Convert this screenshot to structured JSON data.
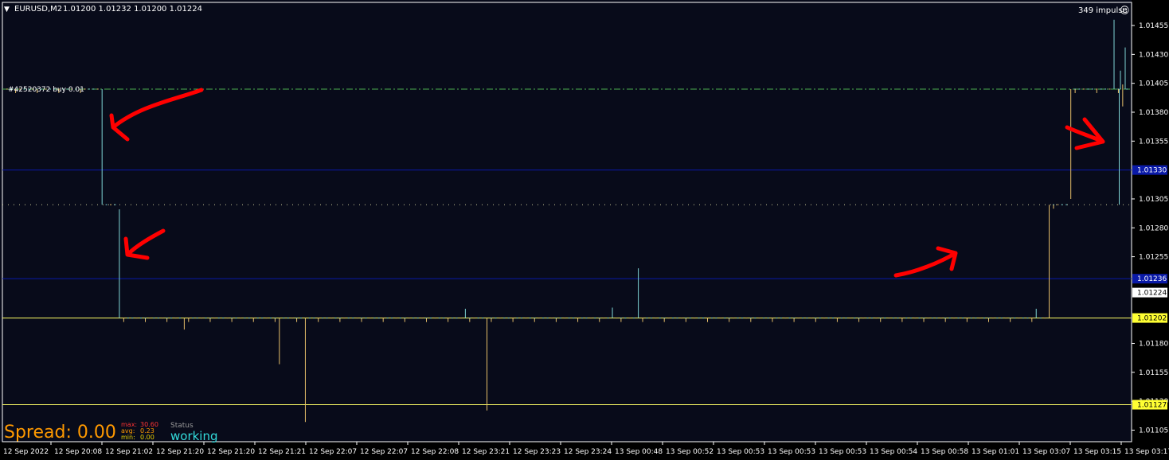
{
  "header": {
    "caret": "▼",
    "symbol_timeframe": "EURUSD,M2",
    "ohlc": "1.01200 1.01232 1.01200 1.01224",
    "indicator_label": "349 impulse",
    "smiley_glyph": "☺"
  },
  "trade": {
    "label": "#42520372 buy 0.01"
  },
  "spread": {
    "label": "Spread: 0.00",
    "max_label": "max:",
    "max_value": "30.60",
    "avg_label": "avg:",
    "avg_value": "0.23",
    "min_label": "min:",
    "min_value": "0.00",
    "status_label": "Status",
    "status_value": "working"
  },
  "colors": {
    "background": "#080b1a",
    "axis_bg": "#000000",
    "grid_text": "#ffffff",
    "bull": "#7fd6d6",
    "bear": "#e8c06a",
    "yellow_line": "#ffff66",
    "blue_line": "#0a1aa8",
    "trade_line": "#4caf50",
    "arrow_red": "#ff0000",
    "spread_orange": "#ff9900",
    "max_red": "#ff3333",
    "avg_orange": "#ff9900",
    "min_yellow": "#e8d000",
    "status_grey": "#9a9a9a",
    "working_cyan": "#33dddd"
  },
  "chart_data": {
    "type": "candlestick",
    "title": "EURUSD,M2",
    "ylim": [
      1.01095,
      1.01475
    ],
    "y_ticks": [
      "1.01455",
      "1.01430",
      "1.01405",
      "1.01380",
      "1.01355",
      "1.01305",
      "1.01280",
      "1.01255",
      "1.01180",
      "1.01155",
      "1.01130",
      "1.01105"
    ],
    "price_labels": [
      {
        "value": 1.0133,
        "text": "1.01330",
        "style": "blue-box"
      },
      {
        "value": 1.01236,
        "text": "1.01236",
        "style": "blue-box"
      },
      {
        "value": 1.01224,
        "text": "1.01224",
        "style": "white-box"
      },
      {
        "value": 1.01202,
        "text": "1.01202",
        "style": "yellow-box"
      },
      {
        "value": 1.01127,
        "text": "1.01127",
        "style": "yellow-box"
      }
    ],
    "horizontal_lines": [
      {
        "name": "trade-entry-line",
        "value": 1.014,
        "style": "trade"
      },
      {
        "name": "upper-blue-level",
        "value": 1.0133,
        "style": "blue"
      },
      {
        "name": "dotted-level",
        "value": 1.013,
        "style": "dotted"
      },
      {
        "name": "lower-blue-level",
        "value": 1.01236,
        "style": "blue"
      },
      {
        "name": "current-yellow-level",
        "value": 1.01202,
        "style": "yellow"
      },
      {
        "name": "bottom-yellow-level",
        "value": 1.01127,
        "style": "yellow"
      }
    ],
    "x_labels": [
      "12 Sep 2022",
      "12 Sep 20:08",
      "12 Sep 21:02",
      "12 Sep 21:20",
      "12 Sep 21:20",
      "12 Sep 21:21",
      "12 Sep 22:07",
      "12 Sep 22:07",
      "12 Sep 22:08",
      "12 Sep 23:21",
      "12 Sep 23:23",
      "12 Sep 23:24",
      "13 Sep 00:48",
      "13 Sep 00:52",
      "13 Sep 00:53",
      "13 Sep 00:53",
      "13 Sep 00:53",
      "13 Sep 00:54",
      "13 Sep 00:58",
      "13 Sep 01:01",
      "13 Sep 03:07",
      "13 Sep 03:15",
      "13 Sep 03:17"
    ],
    "bars": {
      "count": 260,
      "baseline_segments": [
        {
          "from": 0,
          "to": 22,
          "price": 1.014
        },
        {
          "from": 23,
          "to": 26,
          "price": 1.013
        },
        {
          "from": 27,
          "to": 241,
          "price": 1.01202
        },
        {
          "from": 242,
          "to": 246,
          "price": 1.013
        },
        {
          "from": 247,
          "to": 259,
          "price": 1.014
        }
      ],
      "spikes": [
        {
          "index": 22,
          "high": 1.014,
          "low": 1.013,
          "dir": "bull"
        },
        {
          "index": 26,
          "high": 1.01296,
          "low": 1.01202,
          "dir": "bull"
        },
        {
          "index": 41,
          "high": 1.01202,
          "low": 1.01192,
          "dir": "bear"
        },
        {
          "index": 63,
          "high": 1.01202,
          "low": 1.01162,
          "dir": "bear"
        },
        {
          "index": 69,
          "high": 1.01202,
          "low": 1.01112,
          "dir": "bear"
        },
        {
          "index": 106,
          "high": 1.0121,
          "low": 1.01202,
          "dir": "bull"
        },
        {
          "index": 111,
          "high": 1.01202,
          "low": 1.01122,
          "dir": "bear"
        },
        {
          "index": 146,
          "high": 1.01245,
          "low": 1.01202,
          "dir": "bull"
        },
        {
          "index": 140,
          "high": 1.01211,
          "low": 1.01202,
          "dir": "bull"
        },
        {
          "index": 238,
          "high": 1.0121,
          "low": 1.01202,
          "dir": "bull"
        },
        {
          "index": 241,
          "high": 1.013,
          "low": 1.01202,
          "dir": "bear"
        },
        {
          "index": 246,
          "high": 1.014,
          "low": 1.01305,
          "dir": "bear"
        },
        {
          "index": 256,
          "high": 1.0146,
          "low": 1.014,
          "dir": "bull"
        },
        {
          "index": 258,
          "high": 1.01404,
          "low": 1.01385,
          "dir": "bear"
        },
        {
          "index": 260,
          "high": 1.01436,
          "low": 1.014,
          "dir": "bull"
        },
        {
          "index": 272,
          "high": 1.01416,
          "low": 1.014,
          "dir": "bull"
        },
        {
          "index": 275,
          "high": 1.014,
          "low": 1.013,
          "dir": "bull"
        }
      ]
    },
    "annotations": [
      {
        "name": "red-arrow-1",
        "shape": "arrow-down-left"
      },
      {
        "name": "red-arrow-2",
        "shape": "arrow-down-left"
      },
      {
        "name": "red-arrow-3",
        "shape": "arrow-up-right"
      },
      {
        "name": "red-arrow-4",
        "shape": "arrow-right"
      }
    ]
  }
}
